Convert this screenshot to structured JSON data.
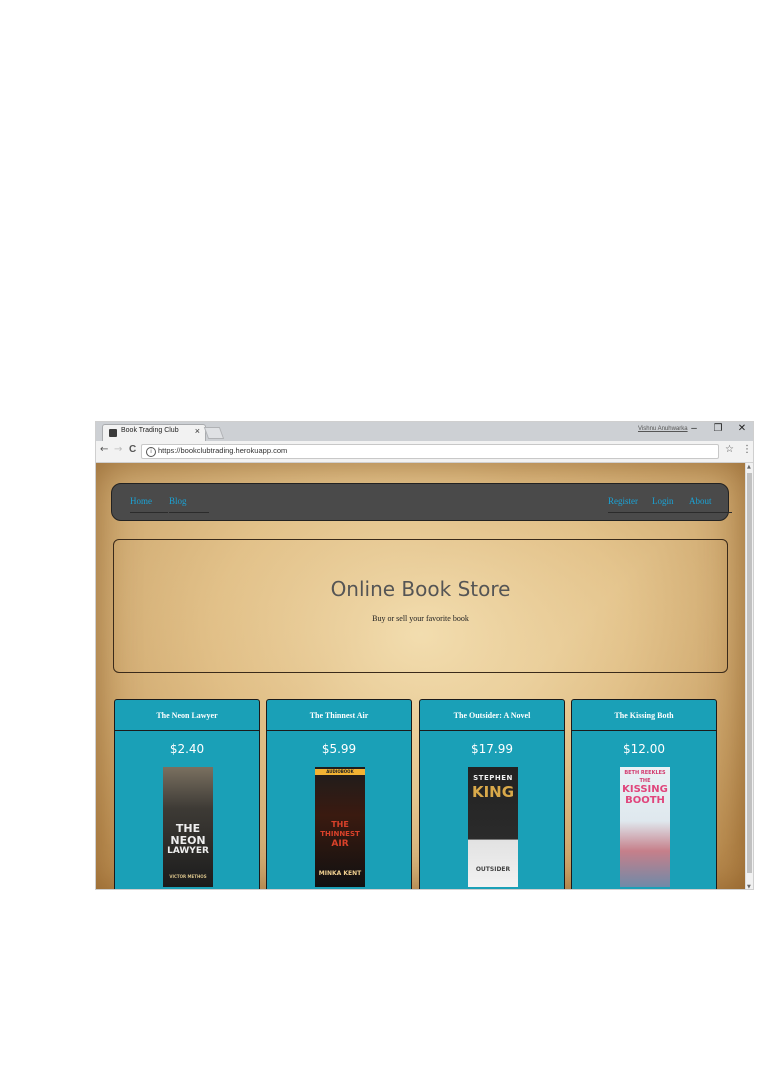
{
  "browser": {
    "tab_title": "Book Trading Club",
    "tab_close": "×",
    "profile_label": "Vishnu Anuhwarka",
    "minimize": "–",
    "restore": "❐",
    "close": "✕",
    "back": "←",
    "forward": "→",
    "reload": "C",
    "url": "https://bookclubtrading.herokuapp.com",
    "star": "☆",
    "menu": "⋮"
  },
  "nav": {
    "left": [
      "Home",
      "Blog"
    ],
    "right": [
      "Register",
      "Login",
      "About"
    ]
  },
  "hero": {
    "title": "Online Book Store",
    "subtitle": "Buy or sell your favorite book"
  },
  "books": [
    {
      "title": "The Neon Lawyer",
      "price": "$2.40",
      "cover_lines": [
        "THE",
        "NEON",
        "LAWYER",
        "VICTOR METHOS"
      ]
    },
    {
      "title": "The Thinnest Air",
      "price": "$5.99",
      "cover_lines": [
        "AUDIOBOOK",
        "THE",
        "THINNEST",
        "AIR",
        "MINKA KENT"
      ]
    },
    {
      "title": "The Outsider: A Novel",
      "price": "$17.99",
      "cover_lines": [
        "STEPHEN",
        "KING",
        "OUTSIDER"
      ]
    },
    {
      "title": "The Kissing Both",
      "price": "$12.00",
      "cover_lines": [
        "BETH REEKLES",
        "THE",
        "KISSING",
        "BOOTH"
      ]
    }
  ],
  "colors": {
    "nav_bg": "#4a4a4a",
    "link": "#1aa3d6",
    "card_bg": "#1aa0b7"
  }
}
